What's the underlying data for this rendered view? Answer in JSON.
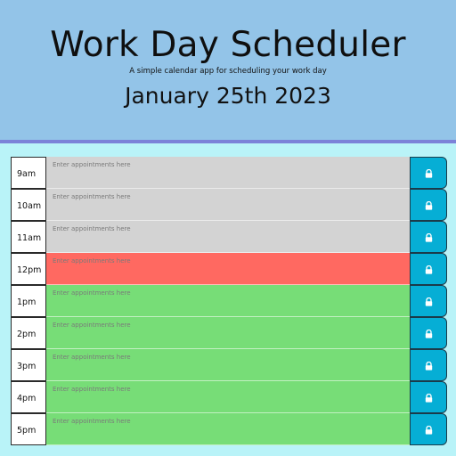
{
  "header": {
    "title": "Work Day Scheduler",
    "subtitle": "A simple calendar app for scheduling your work day",
    "date": "January 25th 2023"
  },
  "colors": {
    "past": "#d3d3d3",
    "present": "#ff6961",
    "future": "#77dd77",
    "save": "#06aed5",
    "header": "#93c4e8",
    "background": "#b9f3f8"
  },
  "rows": [
    {
      "hour": "9am",
      "placeholder": "Enter appointments here",
      "value": "",
      "state": "past",
      "save_icon": "lock-icon"
    },
    {
      "hour": "10am",
      "placeholder": "Enter appointments here",
      "value": "",
      "state": "past",
      "save_icon": "lock-icon"
    },
    {
      "hour": "11am",
      "placeholder": "Enter appointments here",
      "value": "",
      "state": "past",
      "save_icon": "lock-icon"
    },
    {
      "hour": "12pm",
      "placeholder": "Enter appointments here",
      "value": "",
      "state": "present",
      "save_icon": "lock-icon"
    },
    {
      "hour": "1pm",
      "placeholder": "Enter appointments here",
      "value": "",
      "state": "future",
      "save_icon": "lock-icon"
    },
    {
      "hour": "2pm",
      "placeholder": "Enter appointments here",
      "value": "",
      "state": "future",
      "save_icon": "lock-icon"
    },
    {
      "hour": "3pm",
      "placeholder": "Enter appointments here",
      "value": "",
      "state": "future",
      "save_icon": "lock-icon"
    },
    {
      "hour": "4pm",
      "placeholder": "Enter appointments here",
      "value": "",
      "state": "future",
      "save_icon": "lock-icon"
    },
    {
      "hour": "5pm",
      "placeholder": "Enter appointments here",
      "value": "",
      "state": "future",
      "save_icon": "lock-icon"
    }
  ]
}
